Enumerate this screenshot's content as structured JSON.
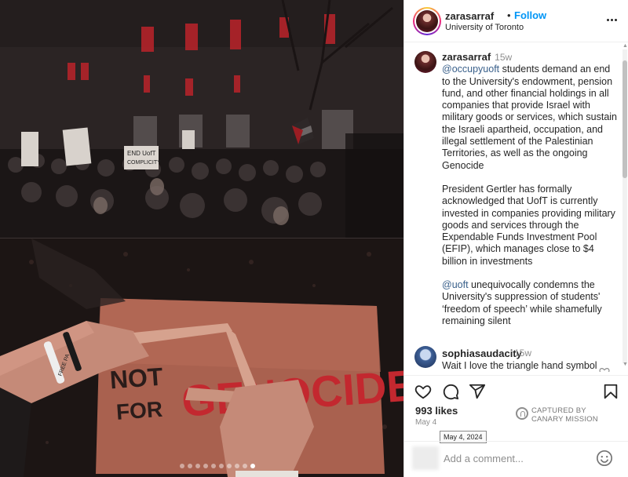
{
  "header": {
    "username": "zarasarraf",
    "separator": "•",
    "follow_label": "Follow",
    "location": "University of Toronto"
  },
  "caption": {
    "username": "zarasarraf",
    "time": "15w",
    "para1_mention": "@occupyuoft",
    "para1_text": " students demand an end to the University's endowment, pension fund, and other financial holdings in all companies that provide Israel with military goods or services, which sustain the Israeli apartheid, occupation, and illegal settlement of the Palestinian Territories, as well as the ongoing Genocide",
    "para2_text": "President Gertler has formally acknowledged that UofT is currently invested in companies providing military goods and services through the Expendable Funds Investment Pool (EFIP), which manages close to $4 billion in investments",
    "para3_mention": "@uoft",
    "para3_text": " unequivocally condemns the University's suppression of students' ‘freedom of speech’ while shamefully remaining silent"
  },
  "reply": {
    "username": "sophiasaudacity",
    "time": "15w",
    "text": "Wait I love the triangle hand symbol"
  },
  "actions": {
    "like_icon": "heart-icon",
    "comment_icon": "comment-icon",
    "share_icon": "share-icon",
    "save_icon": "bookmark-icon"
  },
  "likes": "993 likes",
  "post_date": "May 4",
  "date_tooltip": "May 4, 2024",
  "watermark": {
    "line1": "CAPTURED BY",
    "line2": "CANARY MISSION"
  },
  "add_comment": {
    "placeholder": "Add a comment..."
  },
  "photo": {
    "signs": [
      "END UofT COMPLICITY"
    ],
    "cardboard_text_left": "NOT FOR",
    "cardboard_text_right": "GENOCIDE",
    "bracelet_text": "FREE PA"
  },
  "carousel": {
    "total": 10,
    "active_index": 9
  },
  "colors": {
    "accent": "#0095f6",
    "mention": "#00376b"
  }
}
